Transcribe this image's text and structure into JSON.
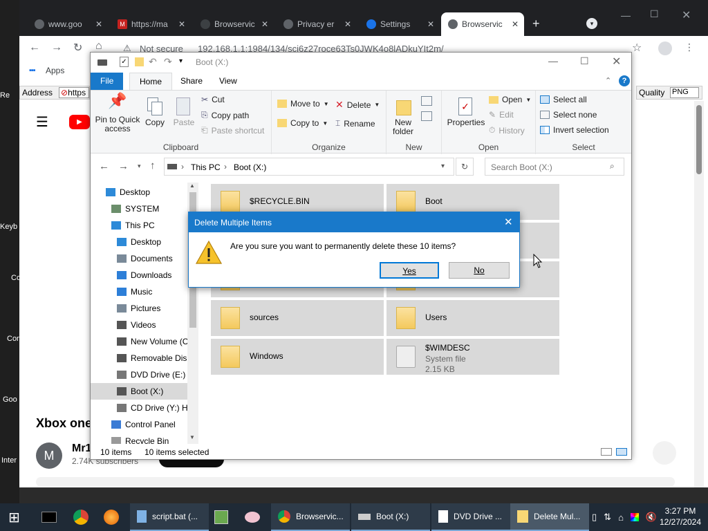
{
  "desktop_labels": [
    "Re",
    "Keyb",
    "Co",
    "Con",
    "Goo",
    "Inter"
  ],
  "browser": {
    "tabs": [
      {
        "title": "www.goo",
        "color": "#9aa0a6"
      },
      {
        "title": "https://ma",
        "color": "#c5221f"
      },
      {
        "title": "Browservic",
        "color": "#3c4043"
      },
      {
        "title": "Privacy er",
        "color": "#9aa0a6"
      },
      {
        "title": "Settings",
        "color": "#1a73e8"
      },
      {
        "title": "Browservic",
        "color": "#5f6368"
      }
    ],
    "not_secure": "Not secure",
    "url": "192.168.1.1:1984/134/sci6z27roce63Ts0JWK4o8lADkuYIt2m/",
    "apps_label": "Apps",
    "address_label": "Address",
    "address_value": "https",
    "quality_label": "Quality",
    "quality_value": "PNG"
  },
  "youtube": {
    "video_title": "Xbox one",
    "channel_initial": "M",
    "channel_name": "Mr1",
    "subscribers": "2.74K subscribers"
  },
  "explorer": {
    "title": "Boot (X:)",
    "ribbon_tabs": [
      "File",
      "Home",
      "Share",
      "View"
    ],
    "clipboard": {
      "pin": "Pin to Quick access",
      "copy": "Copy",
      "paste": "Paste",
      "cut": "Cut",
      "copy_path": "Copy path",
      "paste_shortcut": "Paste shortcut",
      "label": "Clipboard"
    },
    "organize": {
      "move_to": "Move to",
      "copy_to": "Copy to",
      "delete": "Delete",
      "rename": "Rename",
      "label": "Organize"
    },
    "new": {
      "new_folder": "New folder",
      "label": "New"
    },
    "open": {
      "properties": "Properties",
      "open": "Open",
      "edit": "Edit",
      "history": "History",
      "label": "Open"
    },
    "select": {
      "select_all": "Select all",
      "select_none": "Select none",
      "invert": "Invert selection",
      "label": "Select"
    },
    "breadcrumb": [
      "This PC",
      "Boot (X:)"
    ],
    "search_placeholder": "Search Boot (X:)",
    "nav_items": [
      {
        "label": "Desktop",
        "indent": 0,
        "icon": "desktop"
      },
      {
        "label": "SYSTEM",
        "indent": 1,
        "icon": "user"
      },
      {
        "label": "This PC",
        "indent": 1,
        "icon": "pc"
      },
      {
        "label": "Desktop",
        "indent": 2,
        "icon": "desktop"
      },
      {
        "label": "Documents",
        "indent": 2,
        "icon": "doc"
      },
      {
        "label": "Downloads",
        "indent": 2,
        "icon": "download"
      },
      {
        "label": "Music",
        "indent": 2,
        "icon": "music"
      },
      {
        "label": "Pictures",
        "indent": 2,
        "icon": "pic"
      },
      {
        "label": "Videos",
        "indent": 2,
        "icon": "video"
      },
      {
        "label": "New Volume (C",
        "indent": 2,
        "icon": "drive"
      },
      {
        "label": "Removable Dis",
        "indent": 2,
        "icon": "drive"
      },
      {
        "label": "DVD Drive (E:) I",
        "indent": 2,
        "icon": "dvd"
      },
      {
        "label": "Boot (X:)",
        "indent": 2,
        "icon": "drive",
        "selected": true
      },
      {
        "label": "CD Drive (Y:) H",
        "indent": 2,
        "icon": "cd"
      },
      {
        "label": "Control Panel",
        "indent": 1,
        "icon": "cp"
      },
      {
        "label": "Recycle Bin",
        "indent": 1,
        "icon": "bin"
      }
    ],
    "files": [
      {
        "name": "$RECYCLE.BIN",
        "type": "folder"
      },
      {
        "name": "Boot",
        "type": "folder"
      },
      {
        "name": "",
        "type": "folder"
      },
      {
        "name": "",
        "type": "folder"
      },
      {
        "name": "",
        "type": "folder"
      },
      {
        "name": "",
        "type": "folder"
      },
      {
        "name": "sources",
        "type": "folder"
      },
      {
        "name": "Users",
        "type": "folder"
      },
      {
        "name": "Windows",
        "type": "folder"
      },
      {
        "name": "$WIMDESC",
        "type": "file",
        "sub1": "System file",
        "sub2": "2.15 KB"
      }
    ],
    "status_count": "10 items",
    "status_selected": "10 items selected"
  },
  "dialog": {
    "title": "Delete Multiple Items",
    "message": "Are you sure you want to permanently delete these 10 items?",
    "yes": "Yes",
    "no": "No"
  },
  "taskbar": {
    "apps": [
      {
        "label": "script.bat (...",
        "icon": "notepad"
      },
      {
        "label": "Browservic...",
        "icon": "chrome"
      },
      {
        "label": "Boot (X:)",
        "icon": "drive"
      },
      {
        "label": "DVD Drive ...",
        "icon": "doc"
      },
      {
        "label": "Delete Mul...",
        "icon": "folder",
        "active": true
      }
    ],
    "time": "3:27 PM",
    "date": "12/27/2024"
  }
}
